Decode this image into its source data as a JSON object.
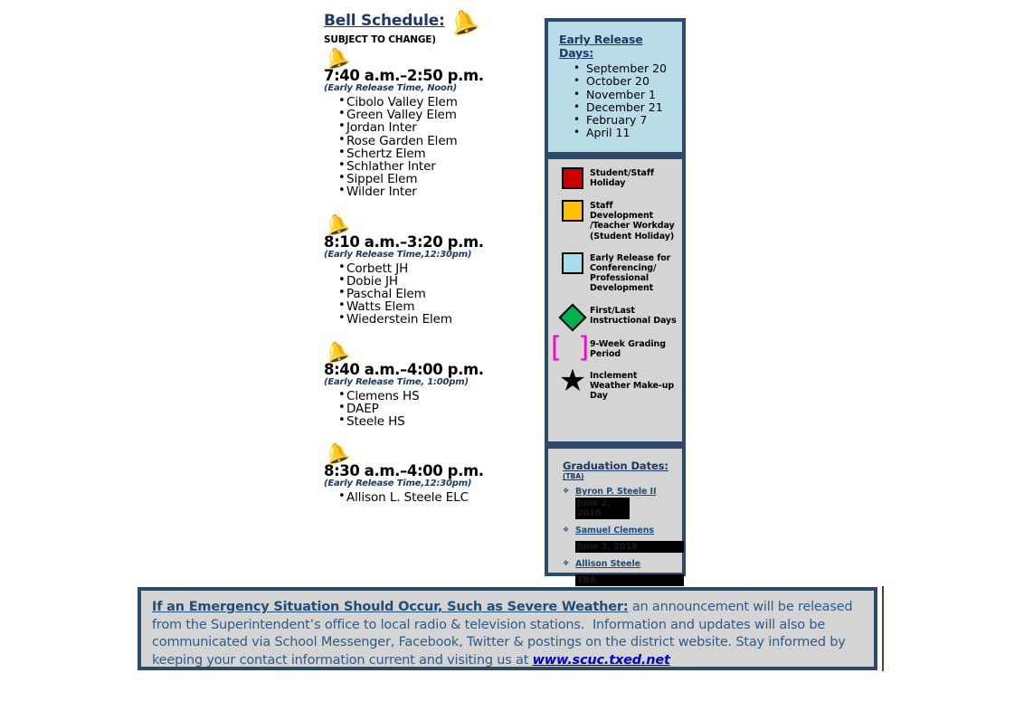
{
  "bell_schedule": {
    "title": "Bell Schedule:",
    "subtitle": "SUBJECT TO CHANGE)",
    "bell_icon": "bell-icon",
    "groups": [
      {
        "time": "7:40 a.m.–2:50 p.m.",
        "early_release": "(Early Release Time, Noon)",
        "schools": [
          "Cibolo Valley Elem",
          "Green Valley Elem",
          "Jordan Inter",
          "Rose Garden Elem",
          "Schertz Elem",
          "Schlather Inter",
          "Sippel Elem",
          "Wilder Inter"
        ]
      },
      {
        "time": "8:10 a.m.–3:20 p.m.",
        "early_release": "(Early Release Time,12:30pm)",
        "schools": [
          "Corbett JH",
          "Dobie JH",
          "Paschal Elem",
          "Watts Elem",
          "Wiederstein Elem"
        ]
      },
      {
        "time": "8:40 a.m.–4:00 p.m.",
        "early_release": "(Early Release Time, 1:00pm)",
        "schools": [
          "Clemens HS",
          "DAEP",
          "Steele HS"
        ]
      },
      {
        "time": "8:30 a.m.–4:00 p.m.",
        "early_release": "(Early Release Time,12:30pm)",
        "schools": [
          "Allison L. Steele ELC"
        ]
      }
    ]
  },
  "early_release": {
    "title": "Early Release Days:",
    "dates": [
      "September 20",
      "October 20",
      "November 1",
      "December 21",
      "February 7",
      "April 11"
    ],
    "background": "#b9dde8"
  },
  "legend": {
    "items": [
      {
        "icon": "red-square-icon",
        "color": "#cc0000",
        "label": "Student/Staff Holiday"
      },
      {
        "icon": "yellow-square-icon",
        "color": "#ffc000",
        "label": "Staff Development /Teacher Workday (Student Holiday)"
      },
      {
        "icon": "cyan-square-icon",
        "color": "#a8dce8",
        "label": "Early Release for Conferencing/ Professional Development"
      },
      {
        "icon": "green-diamond-icon",
        "color": "#00b050",
        "label": "First/Last Instructional Days"
      },
      {
        "icon": "magenta-bracket-icon",
        "color": "#ff00c8",
        "label": "9-Week Grading Period"
      },
      {
        "icon": "black-star-icon",
        "color": "#000000",
        "label": "Inclement Weather Make-up Day"
      }
    ],
    "background": "#d4d4d4"
  },
  "graduation": {
    "title": "Graduation Dates:",
    "tba": "(TBA)",
    "items": [
      {
        "school": "Byron P. Steele II",
        "date": "June 2, 2016",
        "redacted": true
      },
      {
        "school": "Samuel Clemens",
        "date": "June 3, 2016",
        "redacted": true
      },
      {
        "school": "Allison Steele",
        "date": "TBA",
        "redacted": true
      }
    ]
  },
  "emergency_banner": {
    "lead": "If an Emergency Situation Should Occur, Such as Severe Weather:",
    "body": " an announcement will be released from the Superintendent’s office to local radio & television stations.  Information and updates will also be communicated via School Messenger, Facebook, Twitter & postings on the district website. Stay informed by keeping your contact information current and visiting us at ",
    "url": "www.scuc.txed.net",
    "border_color": "#2e4a6b",
    "text_color": "#2e5c8a"
  }
}
